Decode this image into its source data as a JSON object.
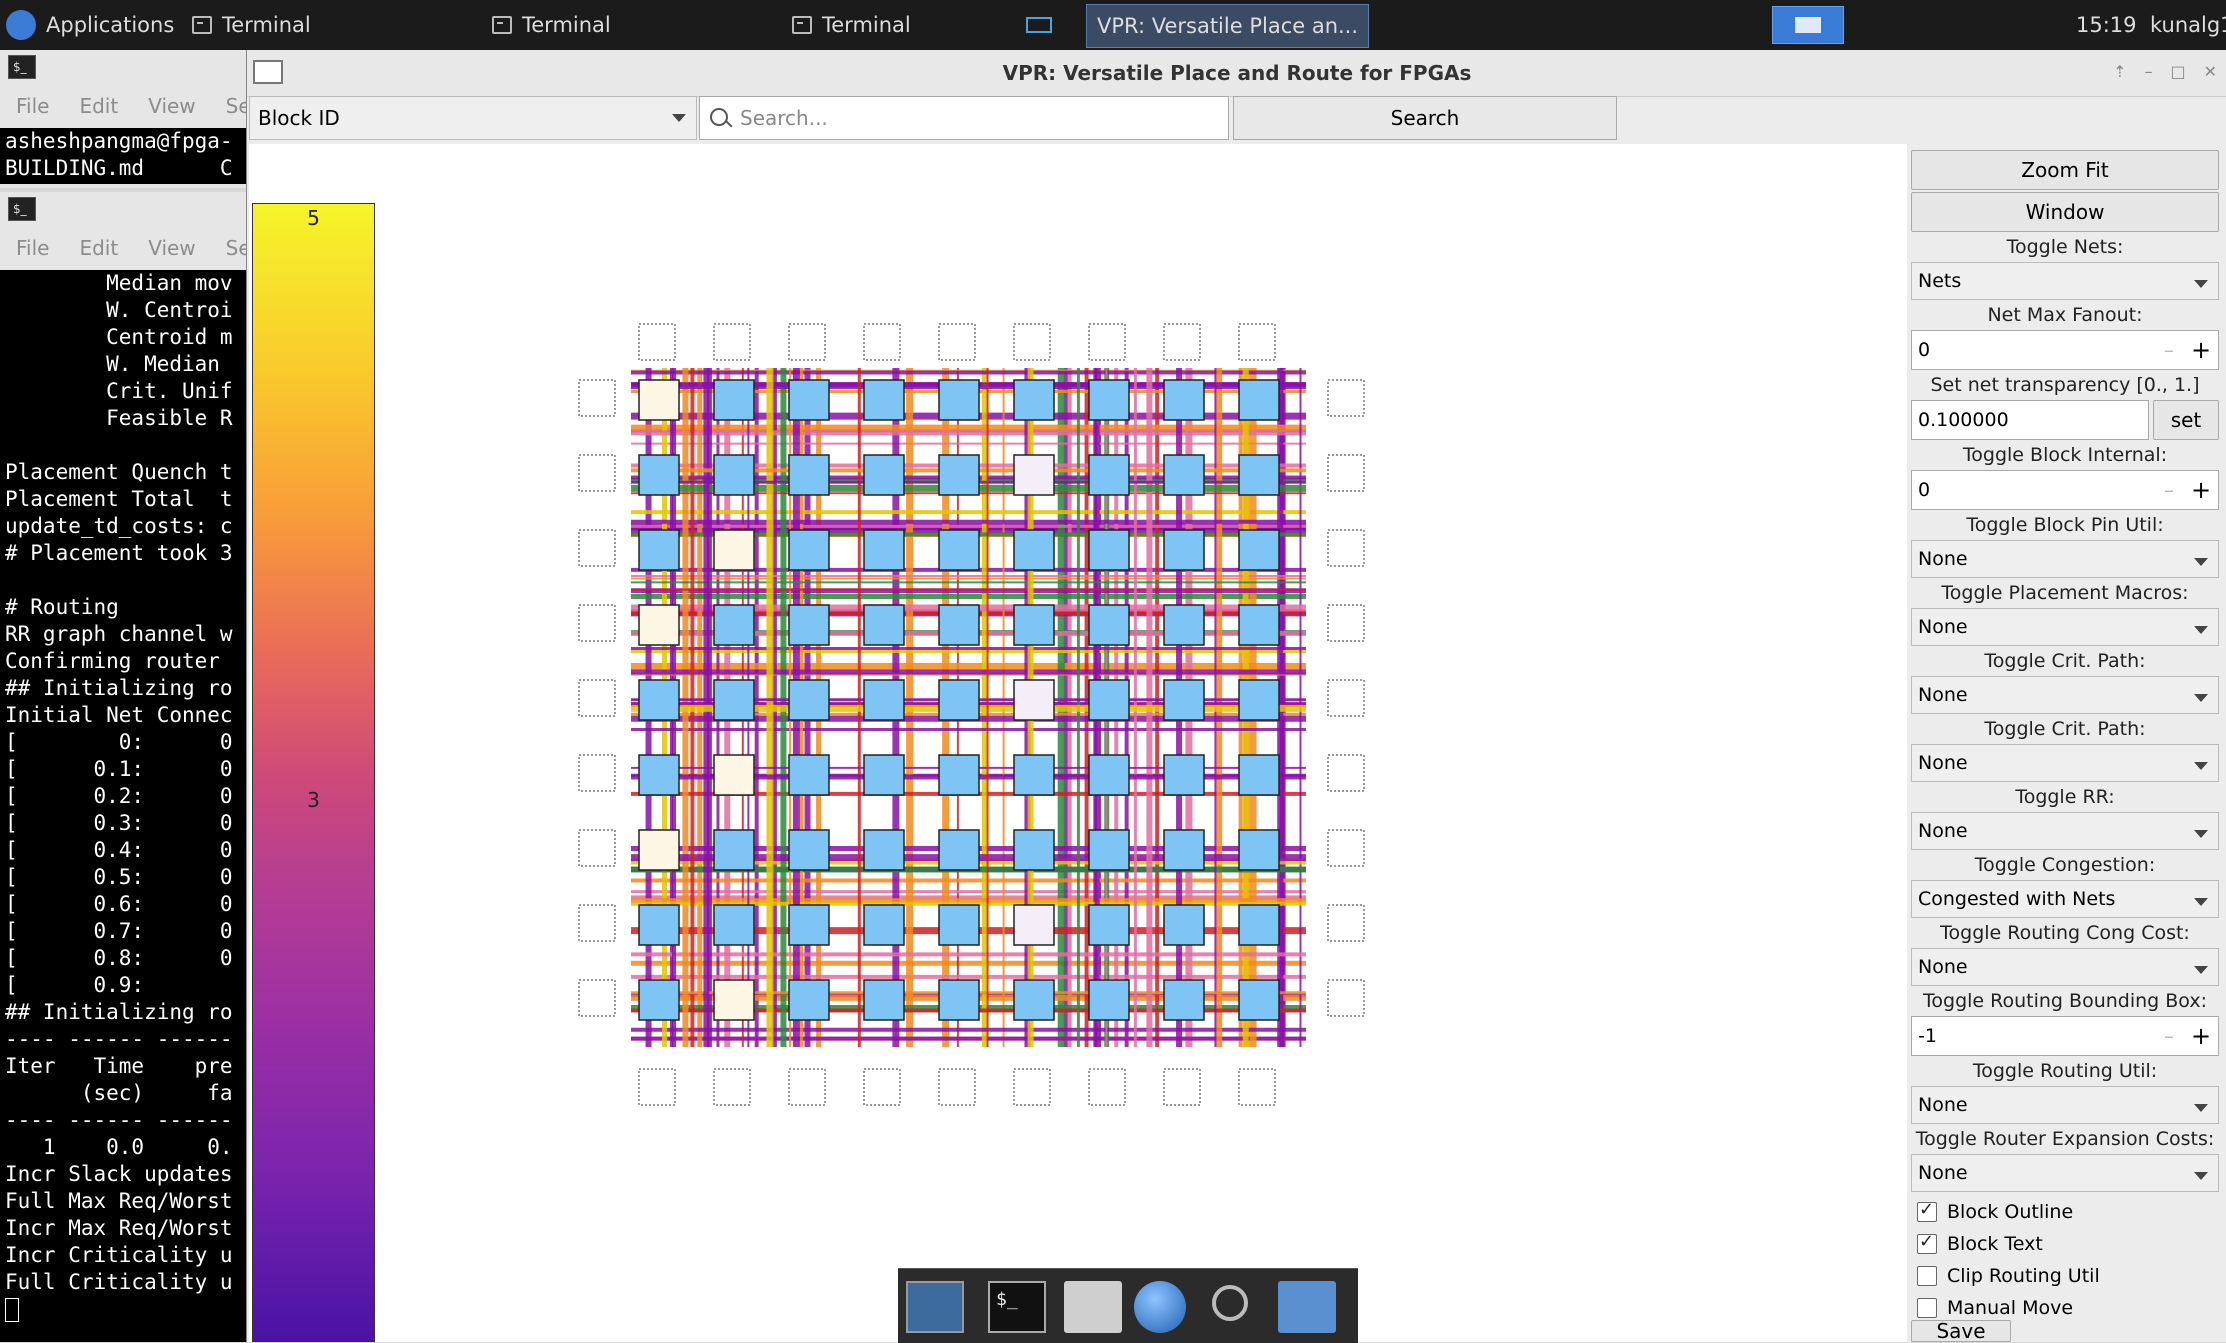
{
  "taskbar": {
    "apps_label": "Applications",
    "terminals": [
      "Terminal",
      "Terminal",
      "Terminal"
    ],
    "active_window": "VPR: Versatile Place an...",
    "clock": "15:19",
    "user": "kunalg1"
  },
  "term1": {
    "menu": [
      "File",
      "Edit",
      "View",
      "Se"
    ],
    "lines": [
      "asheshpangma@fpga-",
      "BUILDING.md      C"
    ]
  },
  "term2": {
    "menu": [
      "File",
      "Edit",
      "View",
      "Se"
    ],
    "lines": [
      "        Median mov",
      "        W. Centroi",
      "        Centroid m",
      "        W. Median ",
      "        Crit. Unif",
      "        Feasible R",
      "",
      "Placement Quench t",
      "Placement Total  t",
      "update_td_costs: c",
      "# Placement took 3",
      "",
      "# Routing",
      "RR graph channel w",
      "Confirming router ",
      "## Initializing ro",
      "Initial Net Connec",
      "[        0:      0",
      "[      0.1:      0",
      "[      0.2:      0",
      "[      0.3:      0",
      "[      0.4:      0",
      "[      0.5:      0",
      "[      0.6:      0",
      "[      0.7:      0",
      "[      0.8:      0",
      "[      0.9:",
      "## Initializing ro",
      "---- ------ ------",
      "Iter   Time    pre",
      "      (sec)     fa",
      "---- ------ ------",
      "   1    0.0     0.",
      "Incr Slack updates",
      "Full Max Req/Worst",
      "Incr Max Req/Worst",
      "Incr Criticality u",
      "Full Criticality u"
    ]
  },
  "vpr": {
    "title": "VPR: Versatile Place and Route for FPGAs",
    "block_id": "Block ID",
    "search_placeholder": "Search...",
    "search_button": "Search",
    "legend": {
      "top": "5",
      "mid": "3"
    },
    "panel": {
      "zoom_fit": "Zoom Fit",
      "window": "Window",
      "toggle_nets_label": "Toggle Nets:",
      "toggle_nets_value": "Nets",
      "net_max_fanout_label": "Net Max Fanout:",
      "net_max_fanout_value": "0",
      "net_transparency_label": "Set net transparency [0., 1.]",
      "net_transparency_value": "0.100000",
      "set_button": "set",
      "block_internal_label": "Toggle Block Internal:",
      "block_internal_value": "0",
      "block_pin_util_label": "Toggle Block Pin Util:",
      "block_pin_util_value": "None",
      "placement_macros_label": "Toggle Placement Macros:",
      "placement_macros_value": "None",
      "crit_path_label_1": "Toggle Crit. Path:",
      "crit_path_value_1": "None",
      "crit_path_label_2": "Toggle Crit. Path:",
      "crit_path_value_2": "None",
      "rr_label": "Toggle RR:",
      "rr_value": "None",
      "congestion_label": "Toggle Congestion:",
      "congestion_value": "Congested with Nets",
      "routing_cong_cost_label": "Toggle Routing Cong Cost:",
      "routing_cong_cost_value": "None",
      "routing_bbox_label": "Toggle Routing Bounding Box:",
      "routing_bbox_value": "-1",
      "routing_util_label": "Toggle Routing Util:",
      "routing_util_value": "None",
      "router_exp_label": "Toggle Router Expansion Costs:",
      "router_exp_value": "None",
      "block_outline": "Block Outline",
      "block_text": "Block Text",
      "clip_routing_util": "Clip Routing Util",
      "manual_move": "Manual Move",
      "save": "Save"
    }
  },
  "colors": {
    "clb": "#7ec4f5",
    "route_purple": "#8a0fa8",
    "route_orange": "#f28a1e",
    "route_pink": "#e26fa0"
  }
}
